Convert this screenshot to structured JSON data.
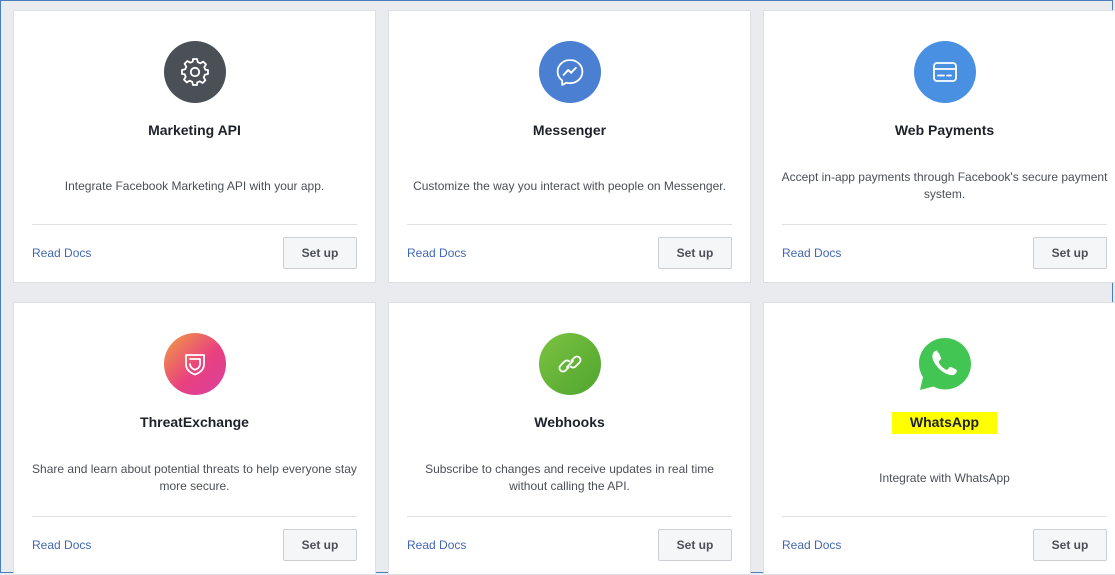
{
  "products": [
    {
      "title": "Marketing API",
      "description": "Integrate Facebook Marketing API with your app.",
      "icon": "gear-icon",
      "icon_color": "#4b4f56",
      "read_docs": "Read Docs",
      "setup": "Set up"
    },
    {
      "title": "Messenger",
      "description": "Customize the way you interact with people on Messenger.",
      "icon": "messenger-icon",
      "icon_color": "#4a7fd1",
      "read_docs": "Read Docs",
      "setup": "Set up"
    },
    {
      "title": "Web Payments",
      "description": "Accept in-app payments through Facebook's secure payment system.",
      "icon": "credit-card-icon",
      "icon_color": "#4a90e2",
      "read_docs": "Read Docs",
      "setup": "Set up"
    },
    {
      "title": "ThreatExchange",
      "description": "Share and learn about potential threats to help everyone stay more secure.",
      "icon": "shield-icon",
      "icon_color": "#e9417f",
      "read_docs": "Read Docs",
      "setup": "Set up"
    },
    {
      "title": "Webhooks",
      "description": "Subscribe to changes and receive updates in real time without calling the API.",
      "icon": "link-icon",
      "icon_color": "#5fb336",
      "read_docs": "Read Docs",
      "setup": "Set up"
    },
    {
      "title": "WhatsApp",
      "description": "Integrate with WhatsApp",
      "icon": "whatsapp-icon",
      "icon_color": "#43c554",
      "read_docs": "Read Docs",
      "setup": "Set up",
      "highlight_color": "#ffff00"
    }
  ]
}
